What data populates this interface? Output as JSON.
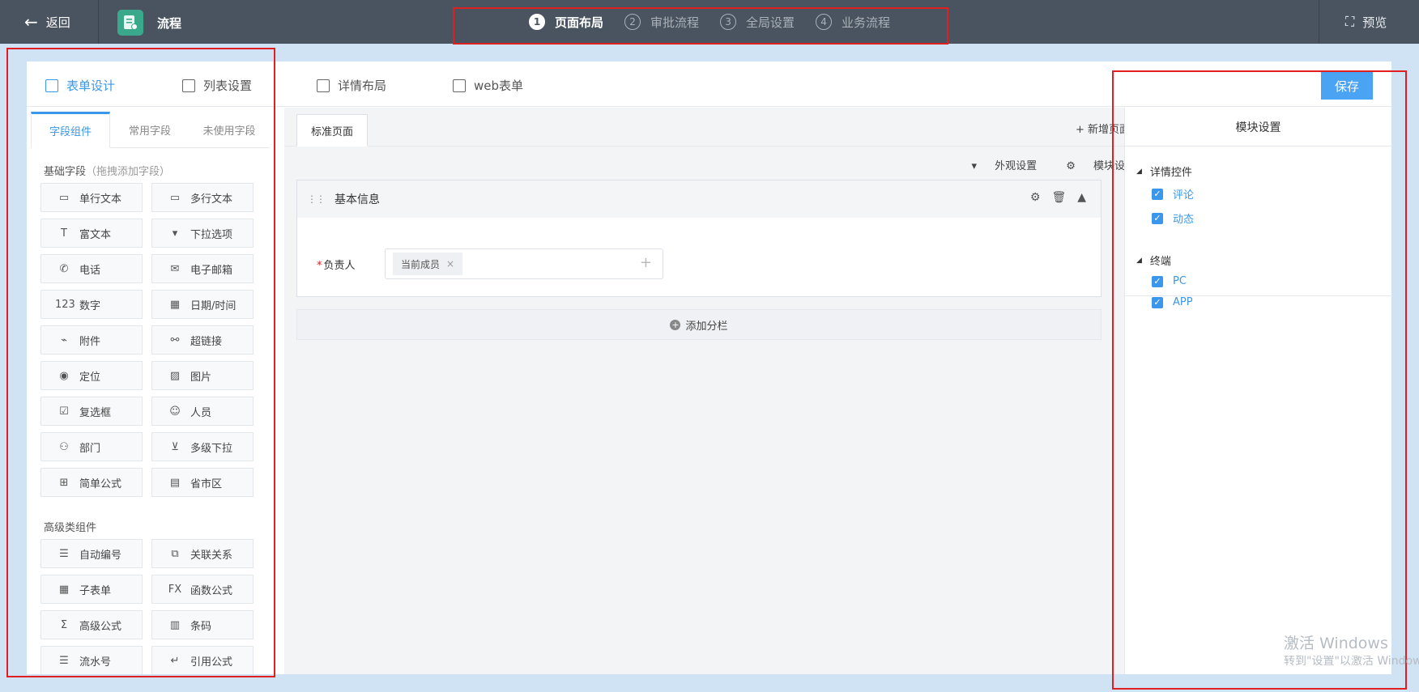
{
  "topbar": {
    "back_label": "返回",
    "app_name": "流程",
    "steps": [
      {
        "num": "1",
        "label": "页面布局",
        "active": true
      },
      {
        "num": "2",
        "label": "审批流程",
        "active": false
      },
      {
        "num": "3",
        "label": "全局设置",
        "active": false
      },
      {
        "num": "4",
        "label": "业务流程",
        "active": false
      }
    ],
    "preview_label": "预览"
  },
  "main_tabs": [
    {
      "label": "表单设计",
      "active": true
    },
    {
      "label": "列表设置",
      "active": false
    },
    {
      "label": "详情布局",
      "active": false
    },
    {
      "label": "web表单",
      "active": false
    }
  ],
  "save_label": "保存",
  "left": {
    "tabs": [
      "字段组件",
      "常用字段",
      "未使用字段"
    ],
    "basic_title": "基础字段",
    "basic_hint": "（拖拽添加字段）",
    "basic_fields": [
      {
        "icon": "text-field-icon",
        "glyph": "▭",
        "label": "单行文本"
      },
      {
        "icon": "textarea-icon",
        "glyph": "▭",
        "label": "多行文本"
      },
      {
        "icon": "rich-text-icon",
        "glyph": "T",
        "label": "富文本"
      },
      {
        "icon": "dropdown-icon",
        "glyph": "▾",
        "label": "下拉选项"
      },
      {
        "icon": "phone-icon",
        "glyph": "✆",
        "label": "电话"
      },
      {
        "icon": "email-icon",
        "glyph": "✉",
        "label": "电子邮箱"
      },
      {
        "icon": "number-icon",
        "glyph": "123",
        "label": "数字"
      },
      {
        "icon": "calendar-icon",
        "glyph": "▦",
        "label": "日期/时间"
      },
      {
        "icon": "attachment-icon",
        "glyph": "⌁",
        "label": "附件"
      },
      {
        "icon": "link-icon",
        "glyph": "⚯",
        "label": "超链接"
      },
      {
        "icon": "location-icon",
        "glyph": "◉",
        "label": "定位"
      },
      {
        "icon": "image-icon",
        "glyph": "▨",
        "label": "图片"
      },
      {
        "icon": "checkbox-icon",
        "glyph": "☑",
        "label": "复选框"
      },
      {
        "icon": "person-icon",
        "glyph": "☺",
        "label": "人员"
      },
      {
        "icon": "department-icon",
        "glyph": "⚇",
        "label": "部门"
      },
      {
        "icon": "cascade-icon",
        "glyph": "⊻",
        "label": "多级下拉"
      },
      {
        "icon": "formula-icon",
        "glyph": "⊞",
        "label": "简单公式"
      },
      {
        "icon": "map-icon",
        "glyph": "▤",
        "label": "省市区"
      }
    ],
    "advanced_title": "高级类组件",
    "advanced_fields": [
      {
        "icon": "numbered-list-icon",
        "glyph": "☰",
        "label": "自动编号"
      },
      {
        "icon": "relation-icon",
        "glyph": "⧉",
        "label": "关联关系"
      },
      {
        "icon": "table-icon",
        "glyph": "▦",
        "label": "子表单"
      },
      {
        "icon": "function-icon",
        "glyph": "FX",
        "label": "函数公式"
      },
      {
        "icon": "sigma-icon",
        "glyph": "Σ",
        "label": "高级公式"
      },
      {
        "icon": "barcode-icon",
        "glyph": "▥",
        "label": "条码"
      },
      {
        "icon": "serial-list-icon",
        "glyph": "☰",
        "label": "流水号"
      },
      {
        "icon": "reference-icon",
        "glyph": "↵",
        "label": "引用公式"
      }
    ]
  },
  "center": {
    "page_tab": "标准页面",
    "add_page": "+ 新增页面",
    "appearance": "外观设置",
    "module_settings": "模块设置",
    "block_title": "基本信息",
    "field_label": "负责人",
    "field_required_mark": "*",
    "tag_value": "当前成员",
    "add_column": "添加分栏"
  },
  "right": {
    "title": "模块设置",
    "groups": [
      {
        "title": "详情控件",
        "items": [
          "评论",
          "动态"
        ]
      },
      {
        "title": "终端",
        "items": [
          "PC",
          "APP"
        ]
      }
    ]
  },
  "watermark": {
    "line1": "激活 Windows",
    "line2": "转到\"设置\"以激活 Windows。"
  },
  "colors": {
    "accent": "#3a97ea",
    "topbar": "#4a5461",
    "highlight_box": "#e02020",
    "brand_logo": "#3aa88a"
  }
}
